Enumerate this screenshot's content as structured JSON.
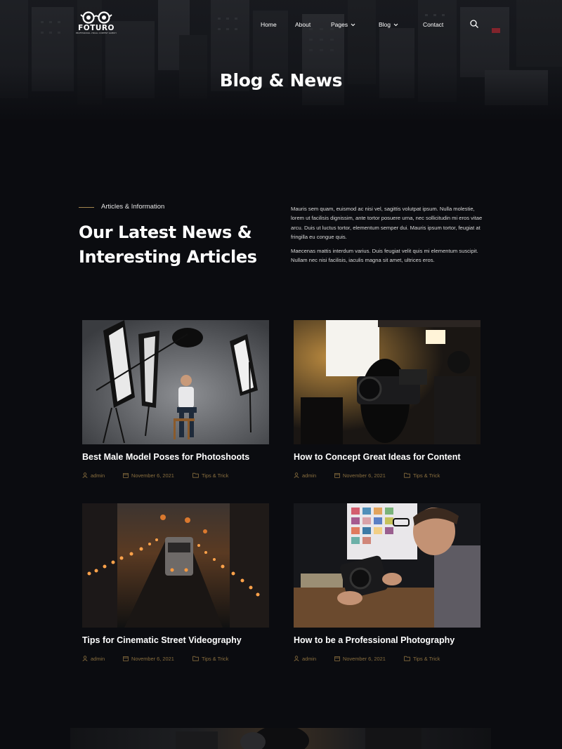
{
  "brand": {
    "name": "FOTURO",
    "tagline": "PROFESSIONAL VISUAL CONTENT AGENCY"
  },
  "nav": {
    "items": [
      {
        "label": "Home",
        "has_dropdown": false
      },
      {
        "label": "About",
        "has_dropdown": false
      },
      {
        "label": "Pages",
        "has_dropdown": true
      },
      {
        "label": "Blog",
        "has_dropdown": true
      },
      {
        "label": "Contact",
        "has_dropdown": false
      }
    ],
    "search_icon": "search-icon"
  },
  "hero": {
    "title": "Blog & News"
  },
  "intro": {
    "eyebrow": "Articles & Information",
    "title": "Our Latest News & Interesting Articles",
    "paragraphs": [
      "Mauris sem quam, euismod ac nisi vel, sagittis volutpat ipsum. Nulla molestie, lorem ut facilisis dignissim, ante tortor posuere urna, nec sollicitudin mi eros vitae arcu. Duis ut luctus tortor, elementum semper dui. Mauris ipsum tortor, feugiat at fringilla eu  congue quis.",
      "Maecenas mattis interdum varius. Duis feugiat velit quis mi elementum suscipit. Nullam nec nisi facilisis, iaculis magna sit amet, ultrices eros."
    ]
  },
  "posts": [
    {
      "title": "Best Male Model Poses for Photoshoots",
      "author": "admin",
      "date": "November 6, 2021",
      "category": "Tips & Trick"
    },
    {
      "title": "How to Concept Great Ideas for Content",
      "author": "admin",
      "date": "November 6, 2021",
      "category": "Tips & Trick"
    },
    {
      "title": "Tips for Cinematic Street Videography",
      "author": "admin",
      "date": "November 6, 2021",
      "category": "Tips & Trick"
    },
    {
      "title": "How to be a Professional Photography",
      "author": "admin",
      "date": "November 6, 2021",
      "category": "Tips & Trick"
    }
  ],
  "colors": {
    "background": "#0b0c10",
    "accent": "#a3864e",
    "meta": "#8a6f3f",
    "text": "#ffffff"
  }
}
